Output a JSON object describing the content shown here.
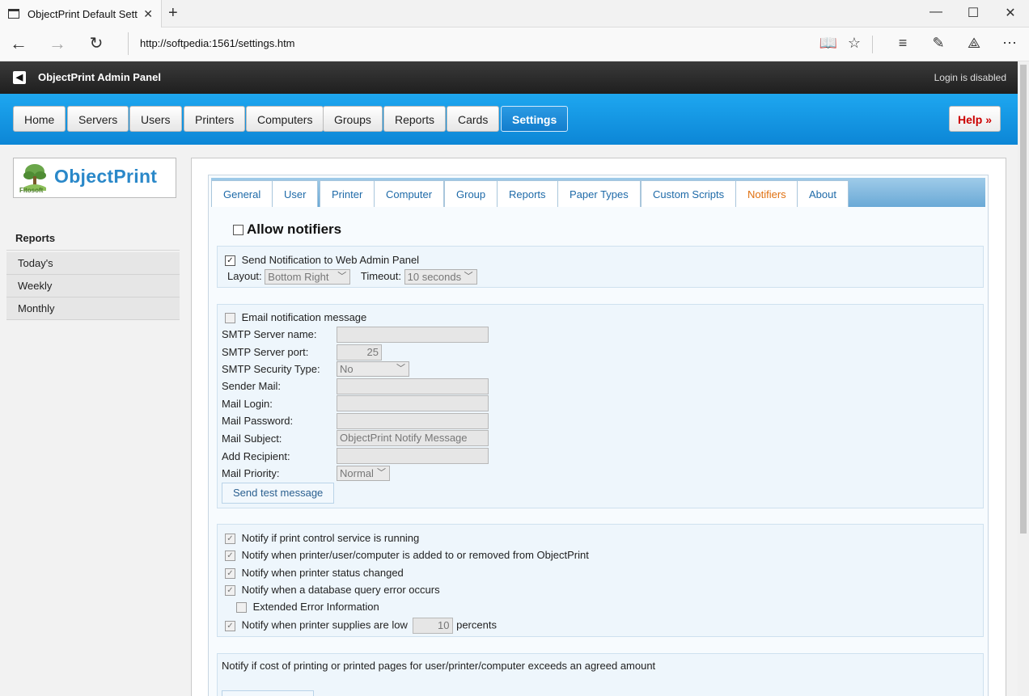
{
  "browser": {
    "tab_title": "ObjectPrint Default Sett",
    "url": "http://softpedia:1561/settings.htm"
  },
  "header": {
    "title": "ObjectPrint Admin Panel",
    "login_status": "Login is disabled"
  },
  "menu": {
    "items": [
      "Home",
      "Servers",
      "Users",
      "Printers",
      "Computers",
      "Groups",
      "Reports",
      "Cards",
      "Settings"
    ],
    "active": "Settings",
    "help": "Help »"
  },
  "sidebar": {
    "logo_text": "ObjectPrint",
    "logo_sub": "Fitosoft",
    "section": "Reports",
    "items": [
      "Today's",
      "Weekly",
      "Monthly"
    ]
  },
  "settings_tabs": {
    "items": [
      "General",
      "User",
      "Printer",
      "Computer",
      "Group",
      "Reports",
      "Paper Types",
      "Custom Scripts",
      "Notifiers",
      "About"
    ],
    "active": "Notifiers"
  },
  "notifiers": {
    "allow_label": "Allow notifiers",
    "web_panel": {
      "label": "Send Notification to Web Admin Panel",
      "layout_label": "Layout:",
      "layout_value": "Bottom Right",
      "timeout_label": "Timeout:",
      "timeout_value": "10 seconds"
    },
    "email": {
      "label": "Email notification message",
      "smtp_server_label": "SMTP Server name:",
      "smtp_port_label": "SMTP Server port:",
      "smtp_port_value": "25",
      "security_label": "SMTP Security Type:",
      "security_value": "No security",
      "sender_label": "Sender Mail:",
      "login_label": "Mail Login:",
      "password_label": "Mail Password:",
      "subject_label": "Mail Subject:",
      "subject_value": "ObjectPrint Notify Message",
      "recipient_label": "Add Recipient:",
      "priority_label": "Mail Priority:",
      "priority_value": "Normal",
      "test_button": "Send test message"
    },
    "events": {
      "service_running": "Notify if print control service is running",
      "added_removed": "Notify when printer/user/computer is added to or removed from ObjectPrint",
      "status_changed": "Notify when printer status changed",
      "db_error": "Notify when a database query error occurs",
      "extended_error": "Extended Error Information",
      "supplies_low": "Notify when printer supplies are low",
      "supplies_value": "10",
      "supplies_unit": "percents"
    },
    "cost": {
      "label": "Notify if cost of printing or printed pages for user/printer/computer exceeds an agreed amount"
    }
  }
}
